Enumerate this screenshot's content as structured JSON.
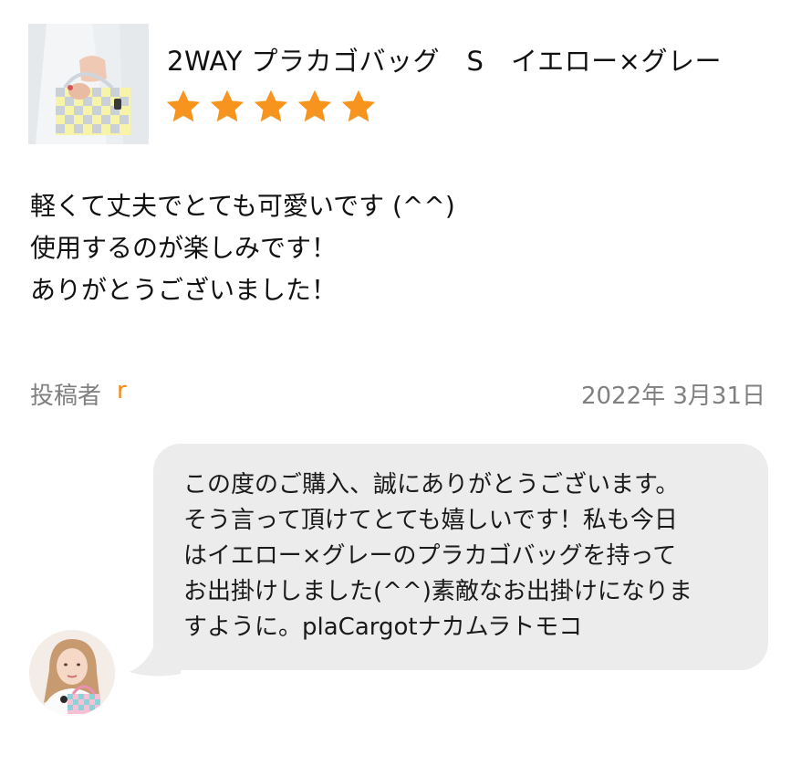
{
  "product": {
    "title": "2WAY プラカゴバッグ　S　イエロー×グレー",
    "thumbnail_icon": "product-photo-bag",
    "rating": 5,
    "rating_max": 5,
    "star_color": "#f7941d"
  },
  "review": {
    "lines": [
      "軽くて丈夫でとても可愛いです (^^)",
      "使用するのが楽しみです！",
      "ありがとうございました！"
    ]
  },
  "meta": {
    "poster_label": "投稿者",
    "poster_name": "r",
    "poster_name_color": "#f28a13",
    "date": "2022年 3月31日"
  },
  "reply": {
    "avatar_icon": "shop-staff-avatar",
    "bubble_color": "#ececec",
    "lines": [
      "この度のご購入、誠にありがとうございます。",
      "そう言って頂けてとても嬉しいです！私も今日",
      "はイエロー×グレーのプラカゴバッグを持って",
      "お出掛けしました(^^)素敵なお出掛けになりま",
      "すように。plaCargotナカムラトモコ"
    ]
  }
}
